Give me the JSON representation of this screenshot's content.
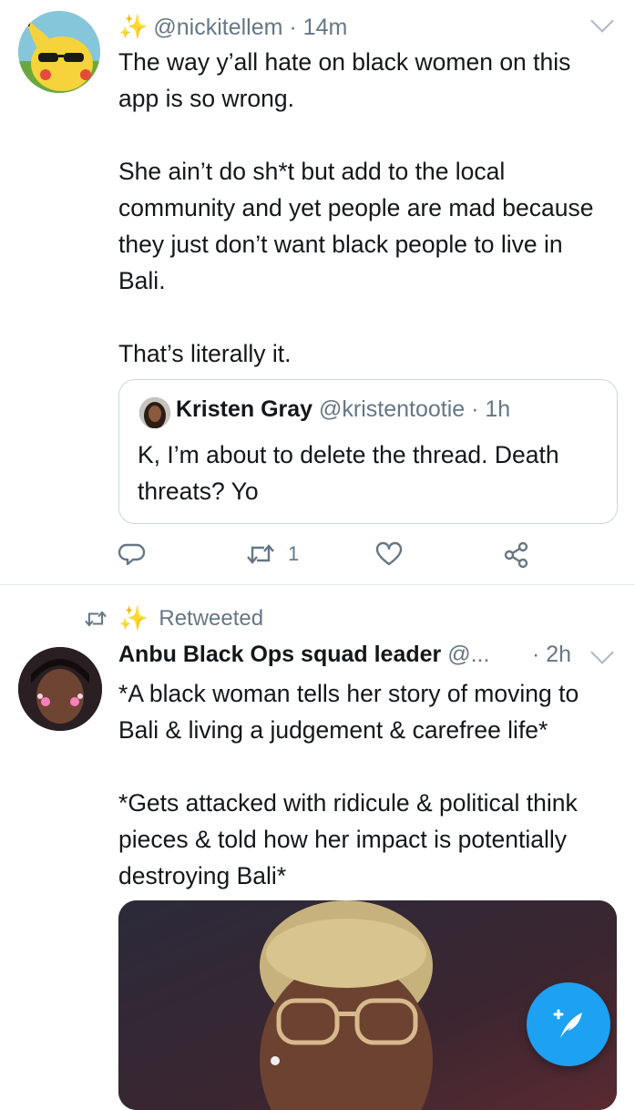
{
  "tweet1": {
    "handle": "@nickitellem",
    "sep": " · ",
    "time": "14m",
    "text": "The way y’all hate on black women on this app is so wrong.\n\nShe ain’t do sh*t but add to the local community and yet people are mad because they just don’t want black people to live in Bali.\n\nThat’s literally it.",
    "quote": {
      "name": "Kristen Gray",
      "handle": "@kristentootie",
      "sep": " · ",
      "time": "1h",
      "text": "K, I’m about to delete the thread. Death threats? Yo"
    },
    "retweet_count": "1"
  },
  "tweet2": {
    "retweeted_label": "Retweeted",
    "name": "Anbu Black Ops squad leader",
    "handle_trunc": "@...",
    "sep": " · ",
    "time": "2h",
    "text": "*A black woman tells her story of moving to Bali & living a judgement & carefree life*\n\n*Gets attacked with ridicule & political think pieces & told how her impact is potentially destroying Bali*"
  },
  "colors": {
    "accent": "#1da1f2",
    "muted": "#657786",
    "border": "#ccd6dd",
    "sparkle": "#f4b400"
  },
  "icons": [
    "sparkle-icon",
    "chevron-down-icon",
    "reply-icon",
    "retweet-icon",
    "like-icon",
    "share-icon",
    "compose-tweet-icon"
  ]
}
